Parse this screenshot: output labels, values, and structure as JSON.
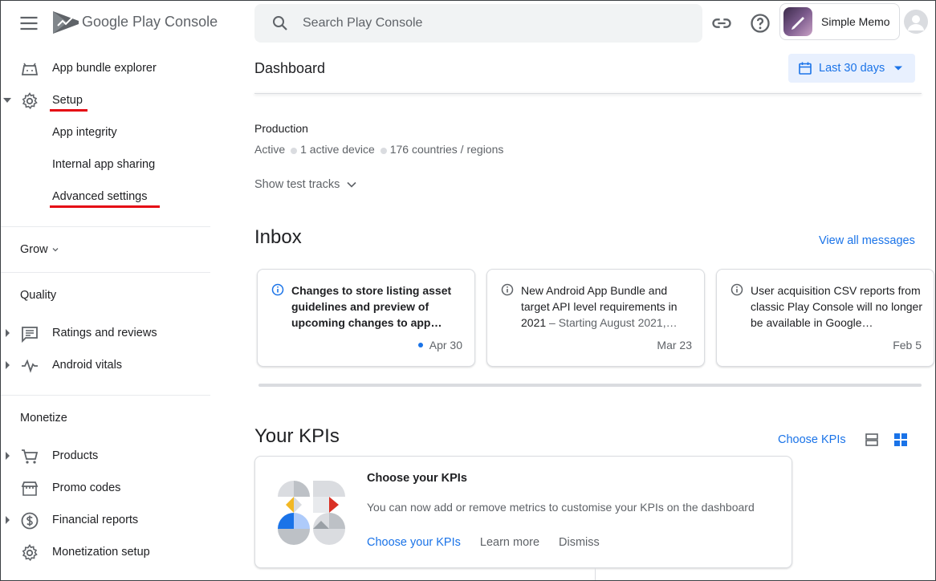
{
  "header": {
    "logo_text": "Google Play Console",
    "search_placeholder": "Search Play Console",
    "app_name": "Simple Memo"
  },
  "sidebar": {
    "items": [
      {
        "label": "App bundle explorer",
        "icon": "android-icon"
      },
      {
        "label": "Setup",
        "icon": "gear-icon",
        "expanded": true
      },
      {
        "label": "App integrity"
      },
      {
        "label": "Internal app sharing"
      },
      {
        "label": "Advanced settings"
      }
    ],
    "grow_label": "Grow",
    "quality_label": "Quality",
    "quality_items": [
      {
        "label": "Ratings and reviews",
        "icon": "review-icon"
      },
      {
        "label": "Android vitals",
        "icon": "vitals-icon"
      }
    ],
    "monetize_label": "Monetize",
    "monetize_items": [
      {
        "label": "Products",
        "icon": "cart-icon"
      },
      {
        "label": "Promo codes",
        "icon": "store-icon"
      },
      {
        "label": "Financial reports",
        "icon": "dollar-icon"
      },
      {
        "label": "Monetization setup",
        "icon": "gear-icon"
      }
    ]
  },
  "main": {
    "title": "Dashboard",
    "date_range": "Last 30 days",
    "production": {
      "title": "Production",
      "status": "Active",
      "devices": "1 active device",
      "countries": "176 countries / regions"
    },
    "show_test_tracks": "Show test tracks",
    "inbox": {
      "title": "Inbox",
      "view_all": "View all messages",
      "messages": [
        {
          "text": "Changes to store listing asset guidelines and preview of upcoming changes to app…",
          "sub": "",
          "date": "Apr 30",
          "unread": true
        },
        {
          "text": "New Android App Bundle and target API level requirements in 2021",
          "sub": " – Starting August 2021,…",
          "date": "Mar 23",
          "unread": false
        },
        {
          "text": "User acquisition CSV reports from classic Play Console will no longer be available in Google…",
          "sub": "",
          "date": "Feb 5",
          "unread": false
        }
      ]
    },
    "kpis": {
      "title": "Your KPIs",
      "choose_link": "Choose KPIs",
      "card_title": "Choose your KPIs",
      "card_desc": "You can now add or remove metrics to customise your KPIs on the dashboard",
      "action_choose": "Choose your KPIs",
      "action_learn": "Learn more",
      "action_dismiss": "Dismiss"
    }
  },
  "colors": {
    "accent": "#1a73e8",
    "highlight_underline": "#e50914"
  }
}
